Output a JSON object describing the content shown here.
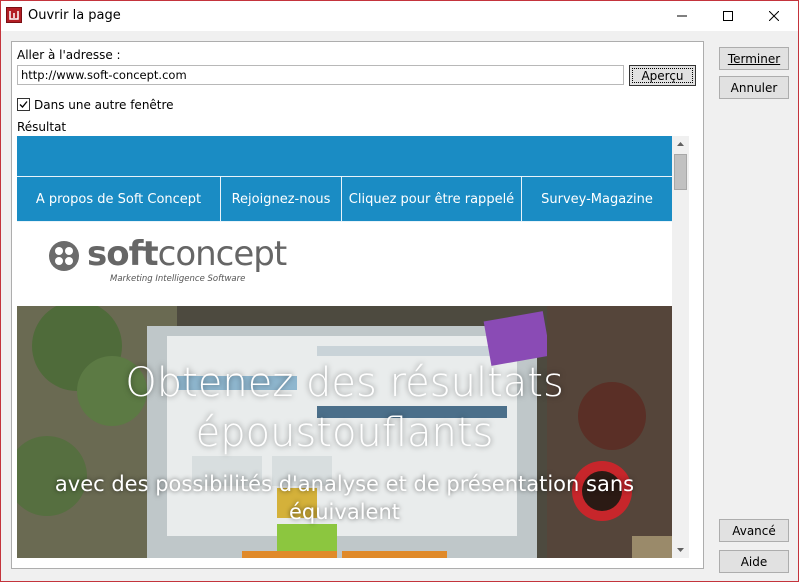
{
  "window": {
    "title": "Ouvrir la page"
  },
  "form": {
    "address_label": "Aller à l'adresse :",
    "address_value": "http://www.soft-concept.com",
    "preview_button": "Aperçu",
    "new_window_label": "Dans une autre fenêtre",
    "new_window_checked": true,
    "result_label": "Résultat"
  },
  "buttons": {
    "finish": "Terminer",
    "cancel": "Annuler",
    "advanced": "Avancé",
    "help": "Aide"
  },
  "site": {
    "nav": [
      "A propos de Soft Concept",
      "Rejoignez-nous",
      "Cliquez pour être rappelé",
      "Survey-Magazine"
    ],
    "logo_soft": "soft",
    "logo_concept": "concept",
    "logo_tagline": "Marketing Intelligence Software",
    "hero_line1": "Obtenez des résultats",
    "hero_line2": "époustouflants",
    "hero_sub1": "avec des possibilités d'analyse et de présentation sans",
    "hero_sub2": "équivalent"
  },
  "colors": {
    "nav_blue": "#1a8cc4",
    "accent": "#c4343c"
  }
}
